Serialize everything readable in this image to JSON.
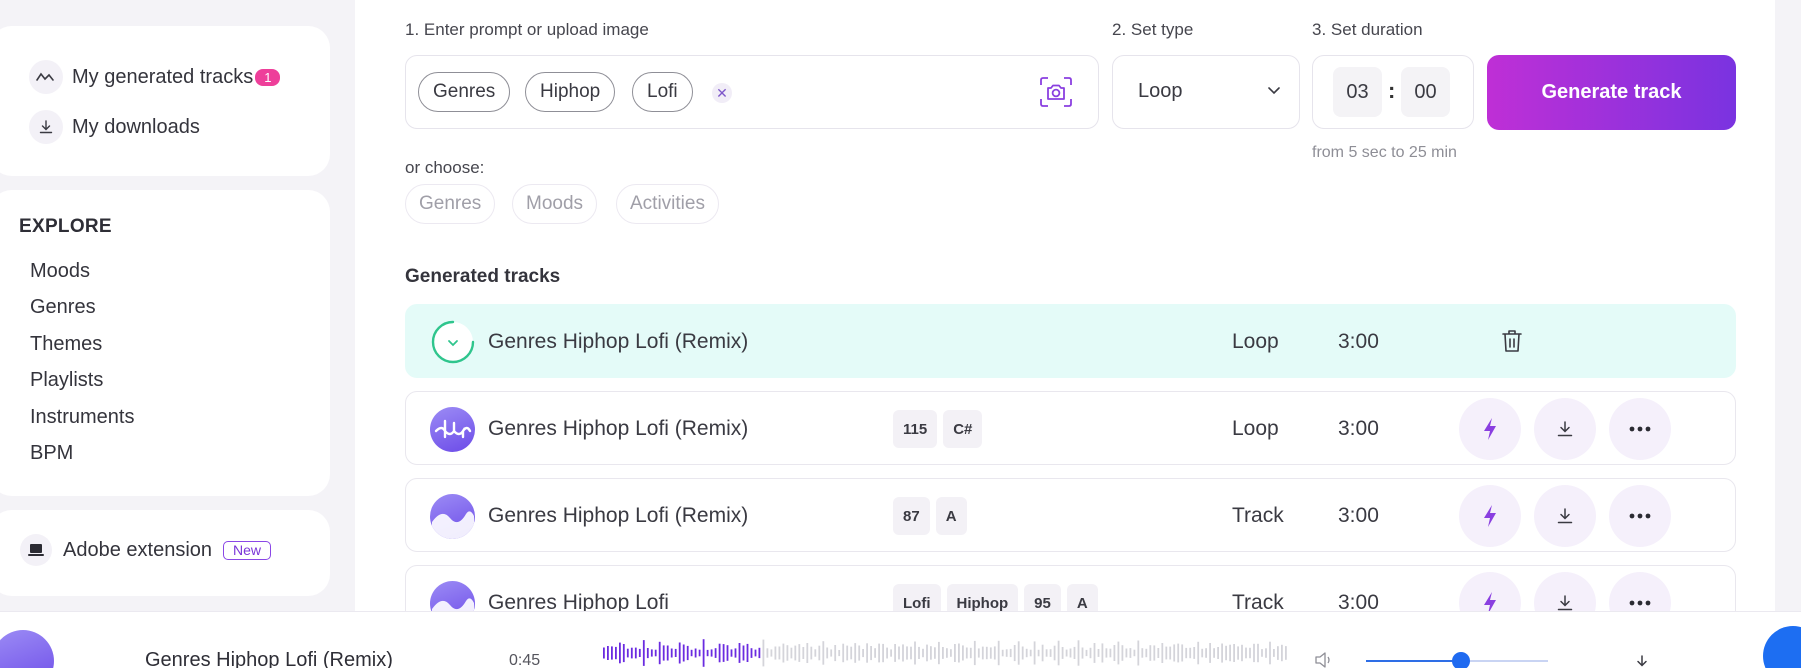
{
  "sidebar": {
    "library": [
      {
        "label": "My generated tracks",
        "badge": "1",
        "icon": "waveform-icon"
      },
      {
        "label": "My downloads",
        "icon": "download-icon"
      }
    ],
    "explore_title": "EXPLORE",
    "explore_links": [
      "Moods",
      "Genres",
      "Themes",
      "Playlists",
      "Instruments",
      "BPM"
    ],
    "adobe": {
      "label": "Adobe extension",
      "tag": "New",
      "icon": "laptop-icon"
    }
  },
  "generator": {
    "step1_label": "1. Enter prompt or upload image",
    "step2_label": "2. Set type",
    "step3_label": "3. Set duration",
    "prompt_chips": [
      "Genres",
      "Hiphop",
      "Lofi"
    ],
    "type_value": "Loop",
    "duration_minutes": "03",
    "duration_seconds": "00",
    "duration_hint": "from 5 sec to 25 min",
    "generate_label": "Generate track",
    "or_choose": "or choose:",
    "categories": [
      "Genres",
      "Moods",
      "Activities"
    ]
  },
  "tracks_section": {
    "title": "Generated tracks",
    "rows": [
      {
        "title": "Genres Hiphop Lofi (Remix)",
        "tags": [],
        "type": "Loop",
        "duration": "3:00",
        "state": "generating"
      },
      {
        "title": "Genres Hiphop Lofi (Remix)",
        "tags": [
          "115",
          "C#"
        ],
        "type": "Loop",
        "duration": "3:00",
        "state": "ready"
      },
      {
        "title": "Genres Hiphop Lofi (Remix)",
        "tags": [
          "87",
          "A"
        ],
        "type": "Track",
        "duration": "3:00",
        "state": "ready"
      },
      {
        "title": "Genres Hiphop Lofi",
        "tags": [
          "Lofi",
          "Hiphop",
          "95",
          "A"
        ],
        "type": "Track",
        "duration": "3:00",
        "state": "ready"
      }
    ]
  },
  "player": {
    "title": "Genres Hiphop Lofi (Remix)",
    "time": "0:45",
    "progress": 0.2,
    "volume": 0.52
  },
  "colors": {
    "accent_start": "#bf2fd6",
    "accent_end": "#7a33e0",
    "active_row": "#e4fbf8",
    "badge": "#ee3f9a",
    "volume": "#1f6af0"
  }
}
